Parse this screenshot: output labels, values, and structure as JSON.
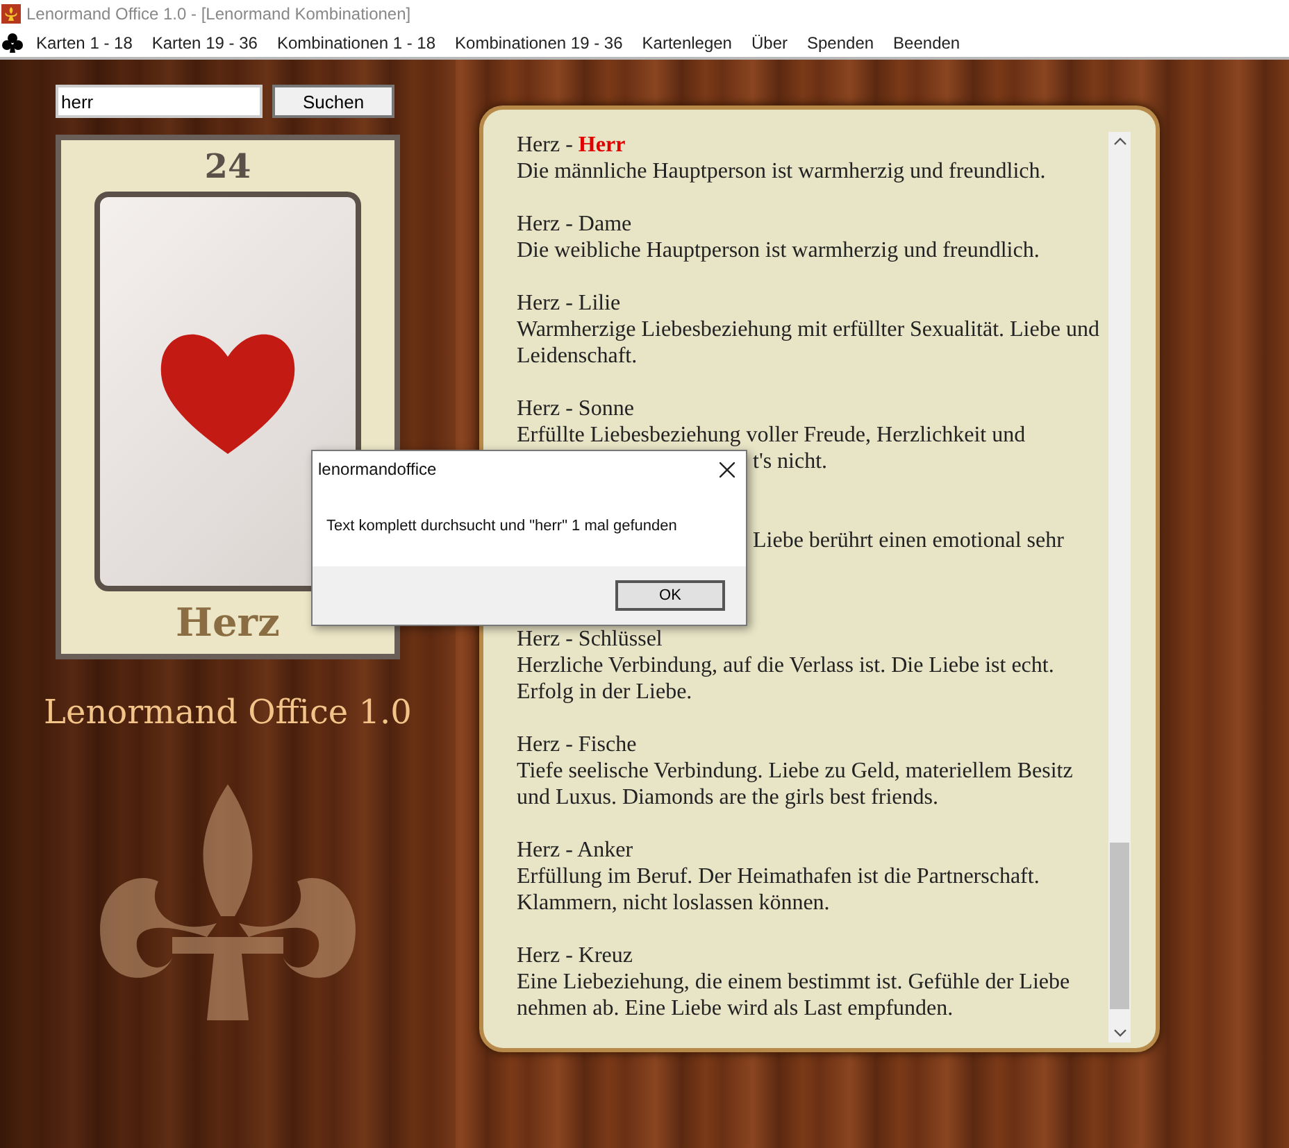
{
  "window": {
    "title": "Lenormand Office 1.0 - [Lenormand Kombinationen]"
  },
  "menu": [
    "Karten 1 - 18",
    "Karten 19 - 36",
    "Kombinationen 1 - 18",
    "Kombinationen 19 - 36",
    "Kartenlegen",
    "Über",
    "Spenden",
    "Beenden"
  ],
  "search": {
    "value": "herr",
    "button": "Suchen"
  },
  "card": {
    "number": "24",
    "name": "Herz"
  },
  "logo": "Lenormand Office 1.0",
  "entries": [
    {
      "title": "Herz - **Herr**",
      "lines": [
        {
          "kind": "full",
          "text": "Die männliche Hauptperson ist warmherzig und freundlich."
        }
      ]
    },
    {
      "title": "Herz - Dame",
      "lines": [
        {
          "kind": "full",
          "text": "Die weibliche Hauptperson ist warmherzig und freundlich."
        }
      ]
    },
    {
      "title": "Herz - Lilie",
      "lines": [
        {
          "kind": "full",
          "text": "Warmherzige Liebesbeziehung mit erfüllter Sexualität. Liebe und Leidenschaft."
        }
      ]
    },
    {
      "title": "Herz - Sonne",
      "lines": [
        {
          "kind": "full",
          "text": "Erfüllte Liebesbeziehung voller Freude, Herzlichkeit und"
        },
        {
          "kind": "cut",
          "text": "t's nicht."
        }
      ]
    },
    {
      "lines": [
        {
          "kind": "cut",
          "text": "Liebe berührt einen emotional sehr"
        }
      ]
    },
    {
      "title": "Herz - Schlüssel",
      "lines": [
        {
          "kind": "full",
          "text": "Herzliche Verbindung, auf die Verlass ist. Die Liebe ist echt. Erfolg in der Liebe."
        }
      ]
    },
    {
      "title": "Herz - Fische",
      "lines": [
        {
          "kind": "full",
          "text": "Tiefe seelische Verbindung. Liebe zu Geld, materiellem Besitz und Luxus. Diamonds are the girls best friends."
        }
      ]
    },
    {
      "title": "Herz - Anker",
      "lines": [
        {
          "kind": "full",
          "text": "Erfüllung im Beruf. Der Heimathafen ist die Partnerschaft. Klammern, nicht loslassen können."
        }
      ]
    },
    {
      "title": "Herz - Kreuz",
      "lines": [
        {
          "kind": "full",
          "text": "Eine Liebeziehung, die einem bestimmt ist. Gefühle der Liebe nehmen ab. Eine Liebe wird als Last empfunden."
        }
      ]
    }
  ],
  "dialog": {
    "title": "lenormandoffice",
    "message": "Text komplett durchsucht und \"herr\" 1 mal gefunden",
    "button": "OK"
  }
}
